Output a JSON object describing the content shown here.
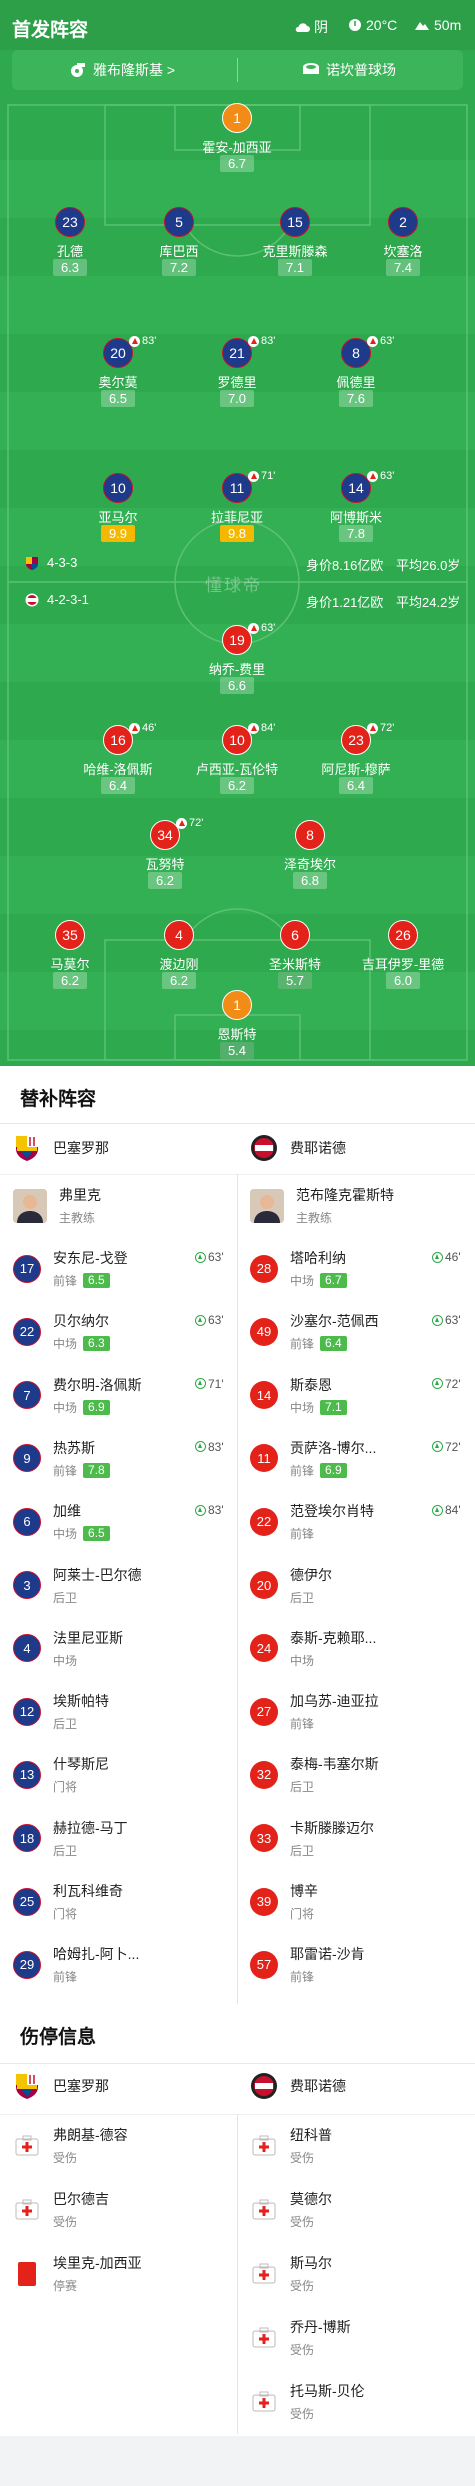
{
  "header": {
    "title": "首发阵容",
    "weather": "阴",
    "temperature": "20°C",
    "altitude": "50m"
  },
  "teams": {
    "home": "雅布隆斯基 >",
    "away": "诺坎普球场"
  },
  "formations": {
    "home": {
      "formation": "4-3-3",
      "value": "身价8.16亿欧",
      "age": "平均26.0岁"
    },
    "away": {
      "formation": "4-2-3-1",
      "value": "身价1.21亿欧",
      "age": "平均24.2岁"
    }
  },
  "watermark": "懂球帝",
  "pitch_players": [
    {
      "num": "1",
      "name": "霍安-加西亚",
      "rating": "6.7",
      "team": "orange"
    },
    {
      "num": "23",
      "name": "孔德",
      "rating": "6.3",
      "team": "blue"
    },
    {
      "num": "5",
      "name": "库巴西",
      "rating": "7.2",
      "team": "blue"
    },
    {
      "num": "15",
      "name": "克里斯滕森",
      "rating": "7.1",
      "team": "blue"
    },
    {
      "num": "2",
      "name": "坎塞洛",
      "rating": "7.4",
      "team": "blue"
    },
    {
      "num": "20",
      "name": "奥尔莫",
      "rating": "6.5",
      "team": "blue",
      "sub": "83'"
    },
    {
      "num": "21",
      "name": "罗德里",
      "rating": "7.0",
      "team": "blue",
      "sub": "83'"
    },
    {
      "num": "8",
      "name": "佩德里",
      "rating": "7.6",
      "team": "blue",
      "sub": "63'"
    },
    {
      "num": "10",
      "name": "亚马尔",
      "rating": "9.9",
      "team": "blue"
    },
    {
      "num": "11",
      "name": "拉菲尼亚",
      "rating": "9.8",
      "team": "blue",
      "sub": "71'"
    },
    {
      "num": "14",
      "name": "阿博斯米",
      "rating": "7.8",
      "team": "blue",
      "sub": "63'"
    },
    {
      "num": "19",
      "name": "纳乔-费里",
      "rating": "6.6",
      "team": "red",
      "sub": "63'"
    },
    {
      "num": "16",
      "name": "哈维-洛佩斯",
      "rating": "6.4",
      "team": "red",
      "sub": "46'"
    },
    {
      "num": "10",
      "name": "卢西亚-瓦伦特",
      "rating": "6.2",
      "team": "red",
      "sub": "84'"
    },
    {
      "num": "23",
      "name": "阿尼斯-穆萨",
      "rating": "6.4",
      "team": "red",
      "sub": "72'"
    },
    {
      "num": "34",
      "name": "瓦努特",
      "rating": "6.2",
      "team": "red",
      "sub": "72'"
    },
    {
      "num": "8",
      "name": "泽奇埃尔",
      "rating": "6.8",
      "team": "red"
    },
    {
      "num": "35",
      "name": "马莫尔",
      "rating": "6.2",
      "team": "red"
    },
    {
      "num": "4",
      "name": "渡边刚",
      "rating": "6.2",
      "team": "red"
    },
    {
      "num": "6",
      "name": "圣米斯特",
      "rating": "5.7",
      "team": "red"
    },
    {
      "num": "26",
      "name": "吉耳伊罗-里德",
      "rating": "6.0",
      "team": "red"
    },
    {
      "num": "1",
      "name": "恩斯特",
      "rating": "5.4",
      "team": "orange"
    }
  ],
  "subs": {
    "title": "替补阵容",
    "home": {
      "team": "巴塞罗那",
      "coach": "弗里克",
      "coach_role": "主教练",
      "players": [
        {
          "num": "17",
          "name": "安东尼-戈登",
          "pos": "前锋",
          "rating": "6.5",
          "time": "63'"
        },
        {
          "num": "22",
          "name": "贝尔纳尔",
          "pos": "中场",
          "rating": "6.3",
          "time": "63'"
        },
        {
          "num": "7",
          "name": "费尔明-洛佩斯",
          "pos": "中场",
          "rating": "6.9",
          "time": "71'"
        },
        {
          "num": "9",
          "name": "热苏斯",
          "pos": "前锋",
          "rating": "7.8",
          "time": "83'"
        },
        {
          "num": "6",
          "name": "加维",
          "pos": "中场",
          "rating": "6.5",
          "time": "83'"
        },
        {
          "num": "3",
          "name": "阿莱士-巴尔德",
          "pos": "后卫"
        },
        {
          "num": "4",
          "name": "法里尼亚斯",
          "pos": "中场"
        },
        {
          "num": "12",
          "name": "埃斯帕特",
          "pos": "后卫"
        },
        {
          "num": "13",
          "name": "什琴斯尼",
          "pos": "门将"
        },
        {
          "num": "18",
          "name": "赫拉德-马丁",
          "pos": "后卫"
        },
        {
          "num": "25",
          "name": "利瓦科维奇",
          "pos": "门将"
        },
        {
          "num": "29",
          "name": "哈姆扎-阿卜...",
          "pos": "前锋"
        }
      ]
    },
    "away": {
      "team": "费耶诺德",
      "coach": "范布隆克霍斯特",
      "coach_role": "主教练",
      "players": [
        {
          "num": "28",
          "name": "塔哈利纳",
          "pos": "中场",
          "rating": "6.7",
          "time": "46'"
        },
        {
          "num": "49",
          "name": "沙塞尔-范佩西",
          "pos": "前锋",
          "rating": "6.4",
          "time": "63'"
        },
        {
          "num": "14",
          "name": "斯泰恩",
          "pos": "中场",
          "rating": "7.1",
          "time": "72'"
        },
        {
          "num": "11",
          "name": "贡萨洛-博尔...",
          "pos": "前锋",
          "rating": "6.9",
          "time": "72'"
        },
        {
          "num": "22",
          "name": "范登埃尔肖特",
          "pos": "前锋",
          "time": "84'"
        },
        {
          "num": "20",
          "name": "德伊尔",
          "pos": "后卫"
        },
        {
          "num": "24",
          "name": "泰斯-克赖耶...",
          "pos": "中场"
        },
        {
          "num": "27",
          "name": "加乌苏-迪亚拉",
          "pos": "前锋"
        },
        {
          "num": "32",
          "name": "泰梅-韦塞尔斯",
          "pos": "后卫"
        },
        {
          "num": "33",
          "name": "卡斯滕滕迈尔",
          "pos": "后卫"
        },
        {
          "num": "39",
          "name": "博辛",
          "pos": "门将"
        },
        {
          "num": "57",
          "name": "耶雷诺-沙肯",
          "pos": "前锋"
        }
      ]
    }
  },
  "injuries": {
    "title": "伤停信息",
    "home": {
      "team": "巴塞罗那",
      "players": [
        {
          "name": "弗朗基-德容",
          "status": "受伤"
        },
        {
          "name": "巴尔德吉",
          "status": "受伤"
        },
        {
          "name": "埃里克-加西亚",
          "status": "停赛"
        }
      ]
    },
    "away": {
      "team": "费耶诺德",
      "players": [
        {
          "name": "纽科普",
          "status": "受伤"
        },
        {
          "name": "莫德尔",
          "status": "受伤"
        },
        {
          "name": "斯马尔",
          "status": "受伤"
        },
        {
          "name": "乔丹-博斯",
          "status": "受伤"
        },
        {
          "name": "托马斯-贝伦",
          "status": "受伤"
        }
      ]
    }
  }
}
